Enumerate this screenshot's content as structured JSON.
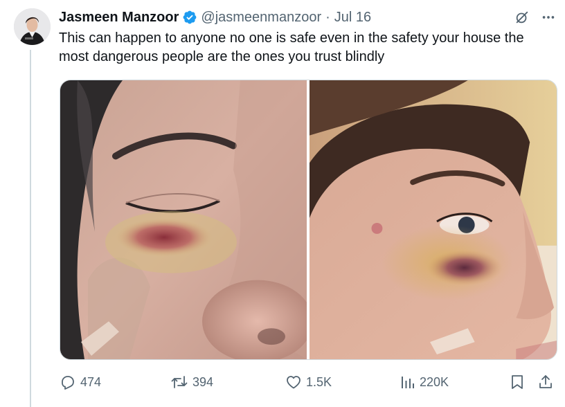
{
  "tweet": {
    "display_name": "Jasmeen Manzoor",
    "handle": "@jasmeenmanzoor",
    "separator": "·",
    "date": "Jul 16",
    "text": "This can happen to anyone no one is safe even in the safety your house the most dangerous people are the ones you trust blindly",
    "media": {
      "left_image_icon": "photo-bruised-eye-closeup",
      "right_image_icon": "photo-bruised-cheek-profile"
    }
  },
  "actions": {
    "replies": "474",
    "reposts": "394",
    "likes": "1.5K",
    "views": "220K"
  },
  "icons": {
    "verified": "verified-badge-icon",
    "grok": "grok-icon",
    "more": "more-icon",
    "reply": "reply-icon",
    "repost": "repost-icon",
    "like": "like-icon",
    "views": "views-icon",
    "bookmark": "bookmark-icon",
    "share": "share-icon"
  },
  "colors": {
    "text": "#0f1419",
    "secondary": "#536471",
    "verified": "#1d9bf0",
    "border": "#cfd9de"
  }
}
